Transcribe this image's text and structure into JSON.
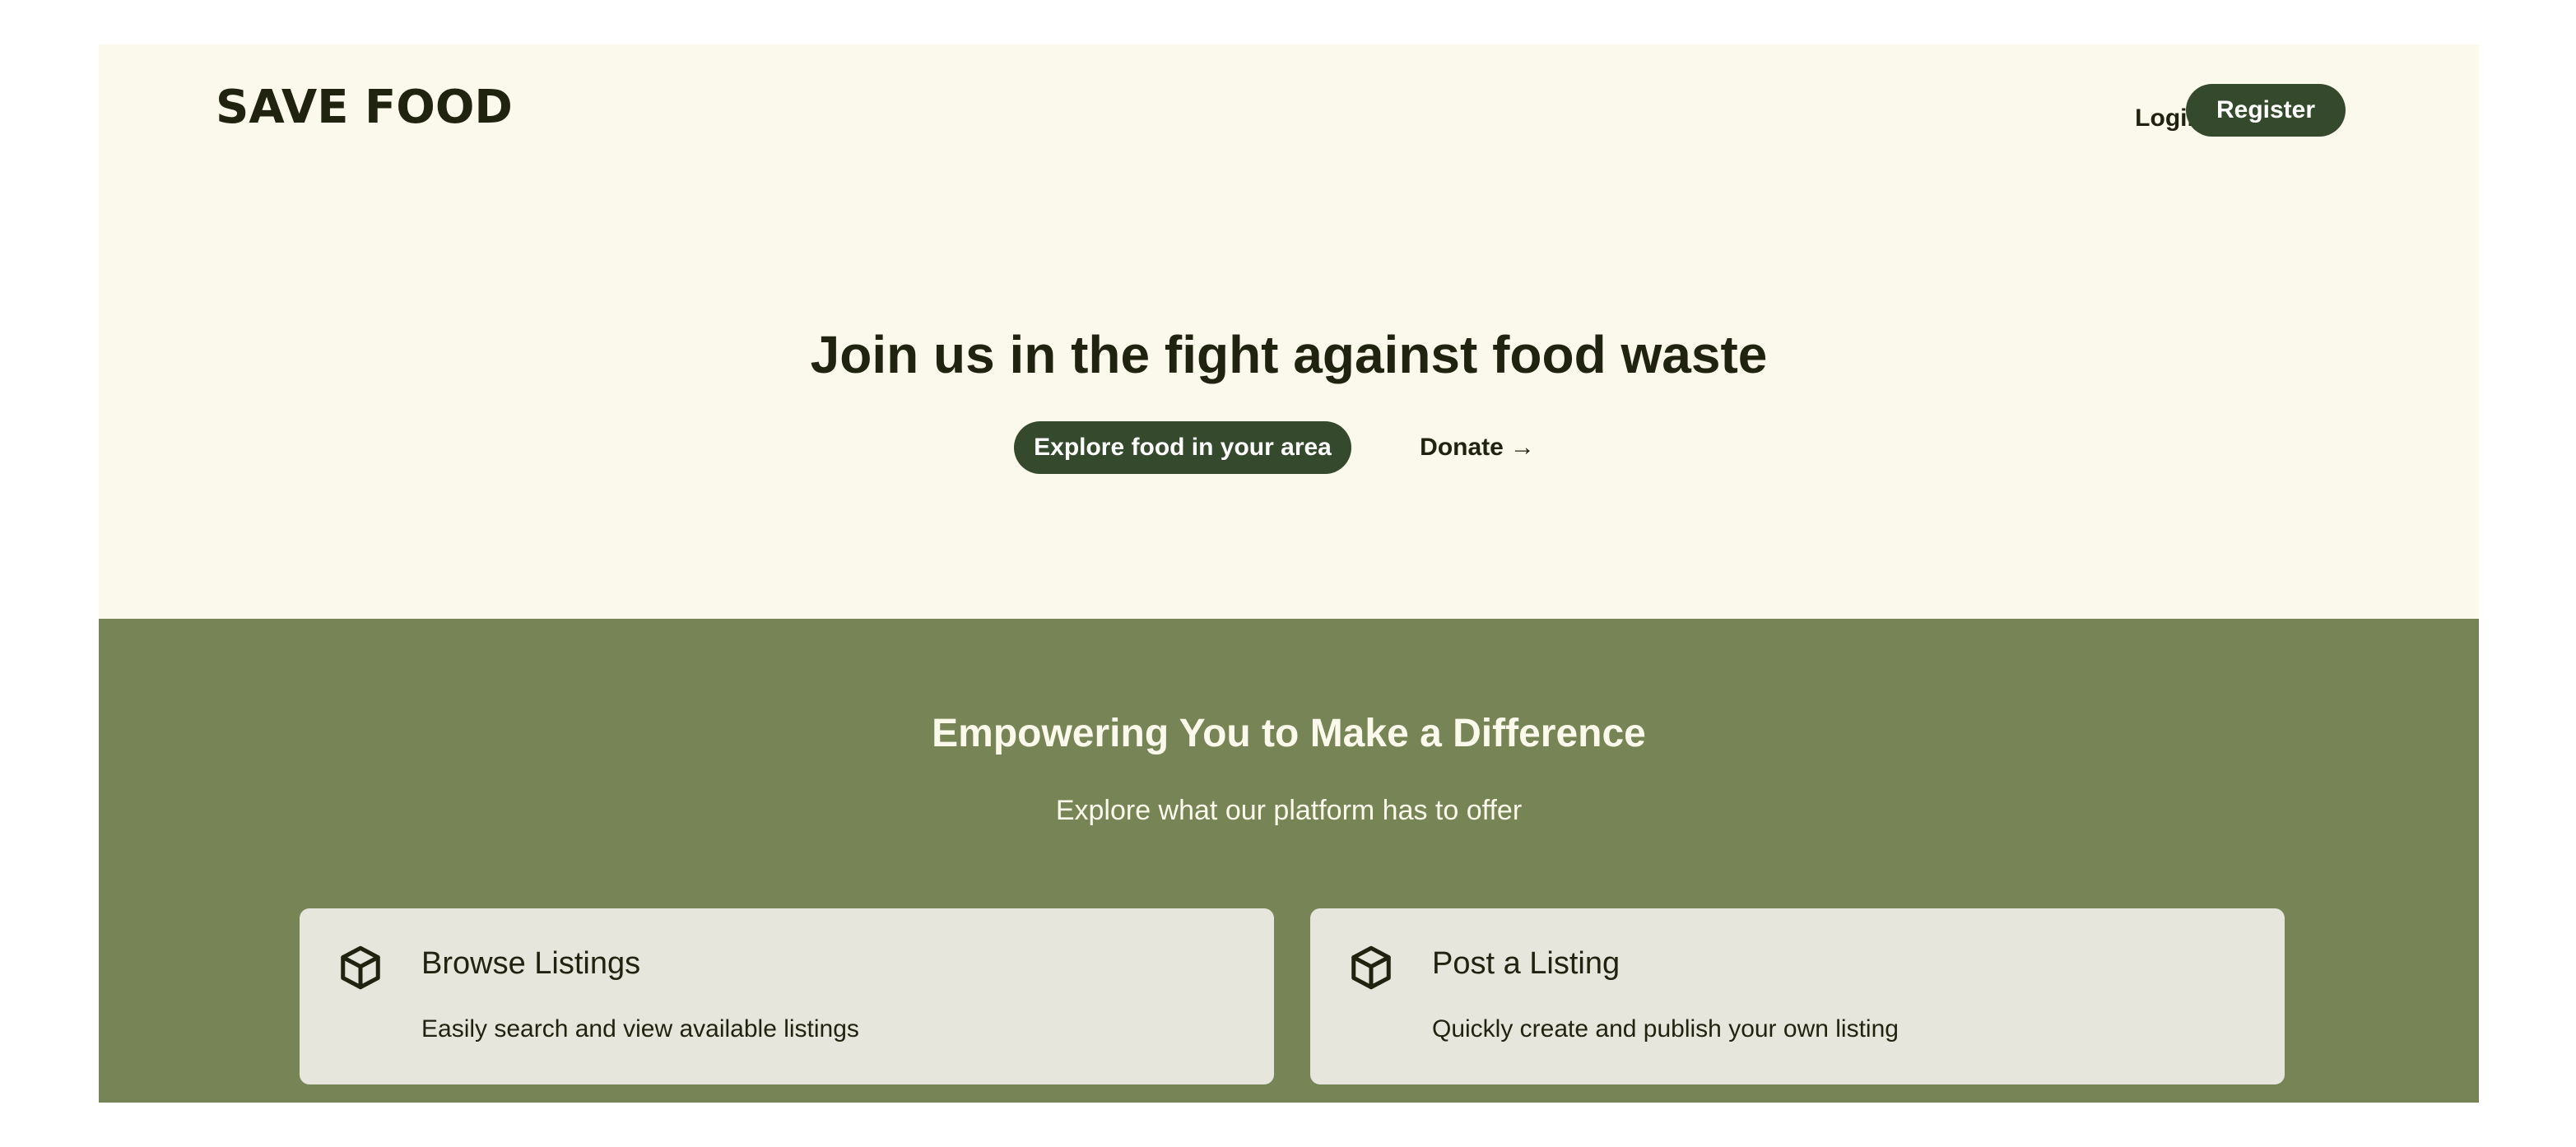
{
  "header": {
    "logo": "SAVE FOOD",
    "login_label": "Login",
    "register_label": "Register"
  },
  "hero": {
    "title": "Join us in the fight against food waste",
    "explore_label": "Explore food in your area",
    "donate_label": "Donate",
    "donate_arrow": "→"
  },
  "features": {
    "title": "Empowering You to Make a Difference",
    "subtitle": "Explore what our platform has to offer",
    "cards": [
      {
        "icon": "box-icon",
        "title": "Browse Listings",
        "text": "Easily search and view available listings"
      },
      {
        "icon": "box-icon",
        "title": "Post a Listing",
        "text": "Quickly create and publish your own listing"
      }
    ]
  },
  "colors": {
    "hero_bg": "#fbf8ec",
    "features_bg": "#778455",
    "button_dark": "#354a2d",
    "card_bg": "#e7e6dc",
    "text_dark": "#20230f"
  }
}
